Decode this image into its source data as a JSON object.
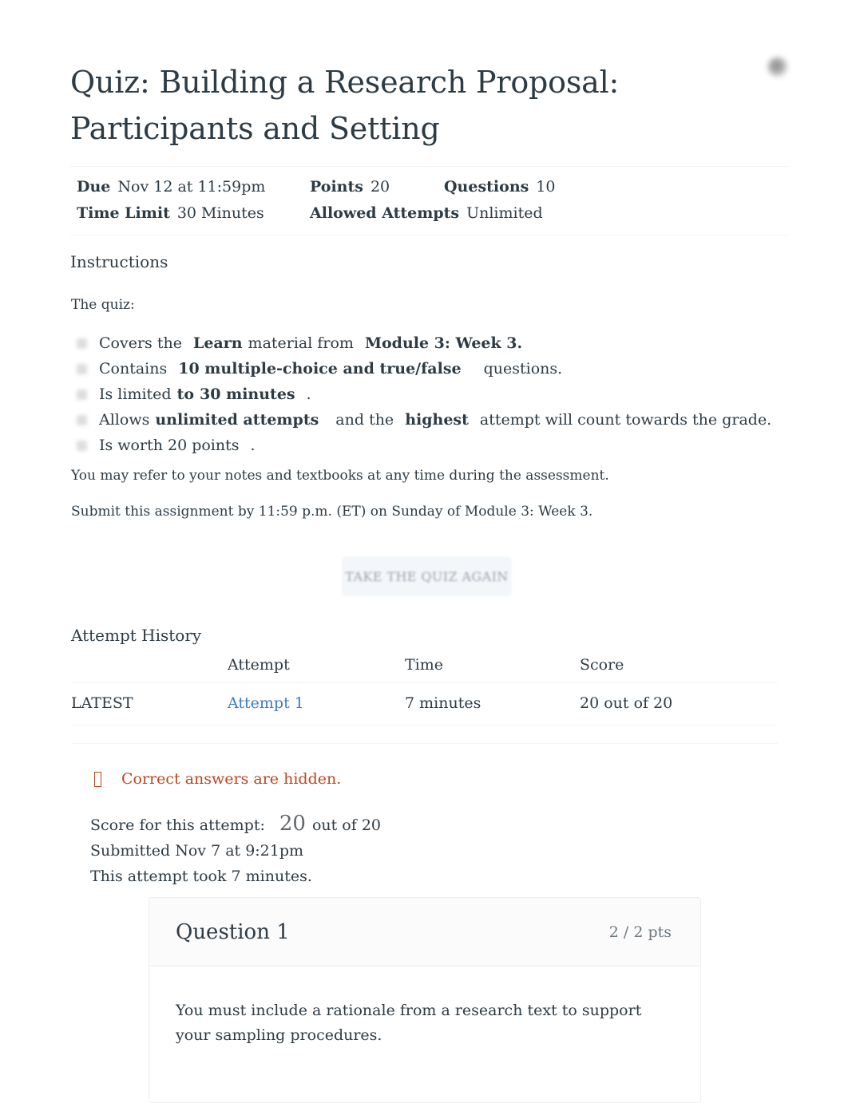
{
  "header": {
    "title": "Quiz: Building a Research Proposal: Participants and Setting",
    "menu_icon": "kebab-menu-icon"
  },
  "meta": {
    "due_label": "Due",
    "due_value": "Nov 12 at 11:59pm",
    "points_label": "Points",
    "points_value": "20",
    "questions_label": "Questions",
    "questions_value": "10",
    "time_limit_label": "Time Limit",
    "time_limit_value": "30 Minutes",
    "allowed_attempts_label": "Allowed Attempts",
    "allowed_attempts_value": "Unlimited"
  },
  "instructions": {
    "heading": "Instructions",
    "intro": "The quiz:",
    "bullets": [
      {
        "p1": "Covers the",
        "b1": "Learn",
        "p2": "material from",
        "b2": "Module 3: Week 3.",
        "p3": ""
      },
      {
        "p1": "Contains",
        "b1": "10 multiple-choice and true/false",
        "p2": "",
        "b2": "",
        "p3": "questions."
      },
      {
        "p1": "Is limited",
        "b1": "to",
        "p2": "30 minutes",
        "b2": "",
        "p3": "."
      },
      {
        "p1": "Allows",
        "b1": "unlimited attempts",
        "p2": "and the",
        "b2": "highest",
        "p3": "attempt will count towards the grade."
      },
      {
        "p1": "Is worth 20 points",
        "b1": "",
        "p2": "",
        "b2": "",
        "p3": "."
      }
    ],
    "note_refer": "You may refer to your notes and textbooks at any time during the assessment.",
    "note_submit": "Submit this assignment by 11:59 p.m. (ET) on Sunday of Module 3: Week 3."
  },
  "actions": {
    "take_quiz_again": "TAKE THE QUIZ AGAIN"
  },
  "attempt_history": {
    "heading": "Attempt History",
    "columns": [
      "",
      "Attempt",
      "Time",
      "Score"
    ],
    "rows": [
      {
        "kept": "LATEST",
        "attempt": "Attempt 1",
        "time": "7 minutes",
        "score": "20 out of 20"
      }
    ]
  },
  "notice": {
    "icon": "warning-tofu-icon",
    "text": "Correct answers are hidden.",
    "color": "#c0441d"
  },
  "score_summary": {
    "score_label": "Score for this attempt:",
    "score_value": "20",
    "score_suffix": "out of 20",
    "submitted": "Submitted Nov 7 at 9:21pm",
    "duration": "This attempt took 7 minutes."
  },
  "question": {
    "name": "Question 1",
    "points": "2 / 2 pts",
    "text": "You must include a rationale from a research text to support your sampling procedures."
  },
  "colors": {
    "link": "#3a7ad1",
    "text": "#2d3b45",
    "muted": "#6b7780",
    "notice": "#c0441d"
  }
}
